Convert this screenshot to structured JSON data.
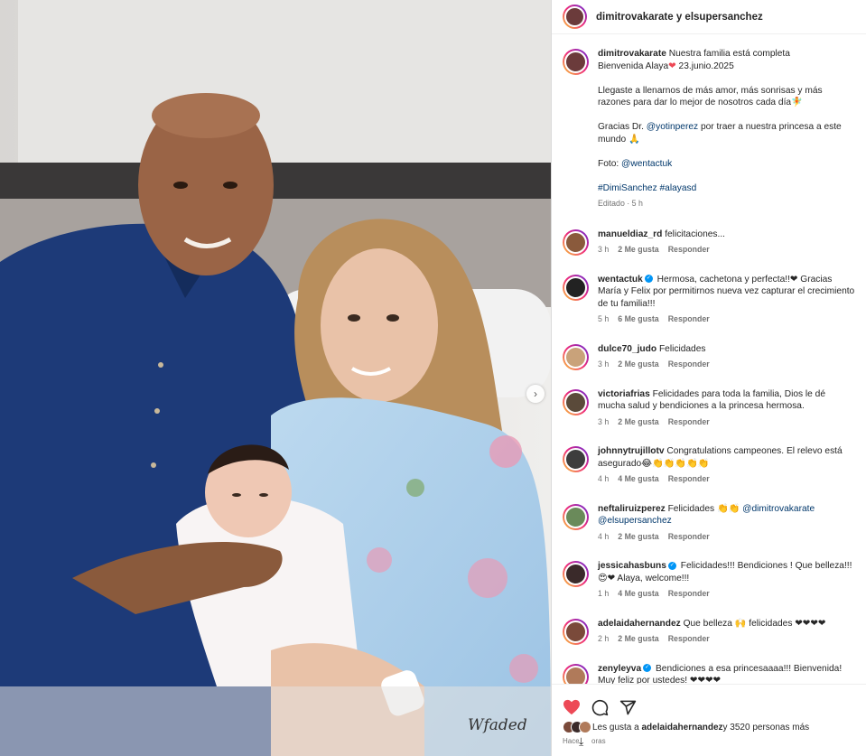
{
  "header": {
    "title": "dimitrovakarate y elsupersanchez"
  },
  "caption": {
    "user": "dimitrovakarate",
    "line1": "Nuestra familia está completa",
    "line2a": "Bienvenida Alaya",
    "line2_emoji": "❤",
    "line2b": " 23.junio.2025",
    "para2a": "Llegaste a llenarnos de más amor, más sonrisas y más razones para dar lo mejor de nosotros cada día",
    "para2_emoji": "🧚",
    "para3a": "Gracias Dr. ",
    "para3_mention": "@yotinperez",
    "para3b": " por traer a nuestra princesa a este mundo ",
    "para3_emoji": "🙏",
    "foto_label": "Foto: ",
    "foto_mention": "@wentactuk",
    "hashtags": "#DimiSanchez #alayasd",
    "meta": "Editado · 5 h"
  },
  "comments": [
    {
      "user": "manueldiaz_rd",
      "text": "felicitaciones...",
      "time": "3 h",
      "likes": "2 Me gusta",
      "reply": "Responder",
      "color": "#8a5a3c"
    },
    {
      "user": "wentactuk",
      "verified": true,
      "text": "Hermosa, cachetona y perfecta!!❤ Gracias María y Felix por permitirnos nueva vez capturar el crecimiento de tu familia!!!",
      "time": "5 h",
      "likes": "6 Me gusta",
      "reply": "Responder",
      "color": "#222222"
    },
    {
      "user": "dulce70_judo",
      "text": "Felicidades",
      "time": "3 h",
      "likes": "2 Me gusta",
      "reply": "Responder",
      "color": "#c9a27a"
    },
    {
      "user": "victoriafrias",
      "text": "Felicidades para toda la familia, Dios le dé mucha salud y bendiciones a la princesa hermosa.",
      "time": "3 h",
      "likes": "2 Me gusta",
      "reply": "Responder",
      "color": "#5a4a3a"
    },
    {
      "user": "johnnytrujillotv",
      "text": "Congratulations campeones. El relevo está asegurado😂👏👏👏👏👏",
      "time": "4 h",
      "likes": "4 Me gusta",
      "reply": "Responder",
      "color": "#3d3d3d"
    },
    {
      "user": "neftaliruizperez",
      "text": "Felicidades 👏👏 ",
      "mention": "@dimitrovakarate @elsupersanchez",
      "time": "4 h",
      "likes": "2 Me gusta",
      "reply": "Responder",
      "color": "#6a8a5a"
    },
    {
      "user": "jessicahasbuns",
      "verified": true,
      "text": "Felicidades!!! Bendiciones ! Que belleza!!! 😍❤ Alaya, welcome!!!",
      "time": "1 h",
      "likes": "4 Me gusta",
      "reply": "Responder",
      "color": "#3a2a2a"
    },
    {
      "user": "adelaidahernandez",
      "text": "Que belleza 🙌 felicidades ❤❤❤❤",
      "time": "2 h",
      "likes": "2 Me gusta",
      "reply": "Responder",
      "color": "#7a4a3a"
    },
    {
      "user": "zenyleyva",
      "verified": true,
      "text": "Bendiciones a esa princesaaaa!!! Bienvenida! Muy feliz por ustedes! ❤❤❤❤",
      "time": "",
      "likes": "",
      "reply": "",
      "color": "#b07a5a"
    }
  ],
  "footer": {
    "likes_prefix": "Les gusta a ",
    "likes_user": "adelaidahernandez",
    "likes_suffix": " y 3520 personas más",
    "ago": "Hace 5 horas"
  },
  "icons": [
    "heart-icon",
    "comment-icon",
    "share-icon",
    "download-icon",
    "chevron-right-icon"
  ],
  "colors": {
    "like_red": "#ed4956",
    "mention": "#00376b",
    "meta_gray": "#737373",
    "verified": "#0095f6"
  }
}
